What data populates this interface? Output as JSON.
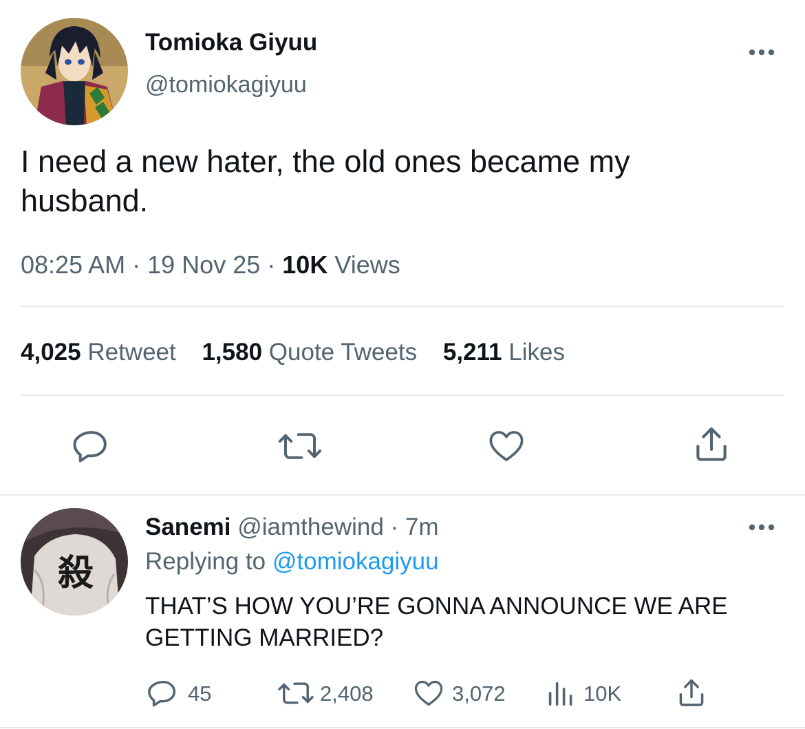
{
  "tweet": {
    "author_name": "Tomioka Giyuu",
    "author_handle": "@tomiokagiyuu",
    "text": "I need a new hater, the old ones became my husband.",
    "time": "08:25 AM",
    "date": "19 Nov 25",
    "views_count": "10K",
    "views_label": "Views",
    "separator": "·",
    "avatar_icon": "anime-boy-avatar-icon"
  },
  "stats": {
    "retweets_count": "4,025",
    "retweets_label": "Retweet",
    "quotes_count": "1,580",
    "quotes_label": "Quote Tweets",
    "likes_count": "5,211",
    "likes_label": "Likes"
  },
  "actions": [
    "reply-icon",
    "retweet-icon",
    "like-icon",
    "share-icon"
  ],
  "reply": {
    "author_name": "Sanemi",
    "author_handle": "@iamthewind",
    "separator": "·",
    "time_ago": "7m",
    "replying_prefix": "Replying to",
    "replying_handle": "@tomiokagiyuu",
    "text_line1": "THAT’S HOW YOU’RE GONNA ANNOUNCE WE ARE",
    "text_line2": "GETTING MARRIED?",
    "reply_count": "45",
    "retweet_count": "2,408",
    "like_count": "3,072",
    "view_count": "10K",
    "avatar_icon": "kanji-jacket-avatar-icon"
  },
  "colors": {
    "text": "#0f1419",
    "secondary": "#536471",
    "link": "#1d9bf0",
    "divider": "#e6e9eb"
  }
}
